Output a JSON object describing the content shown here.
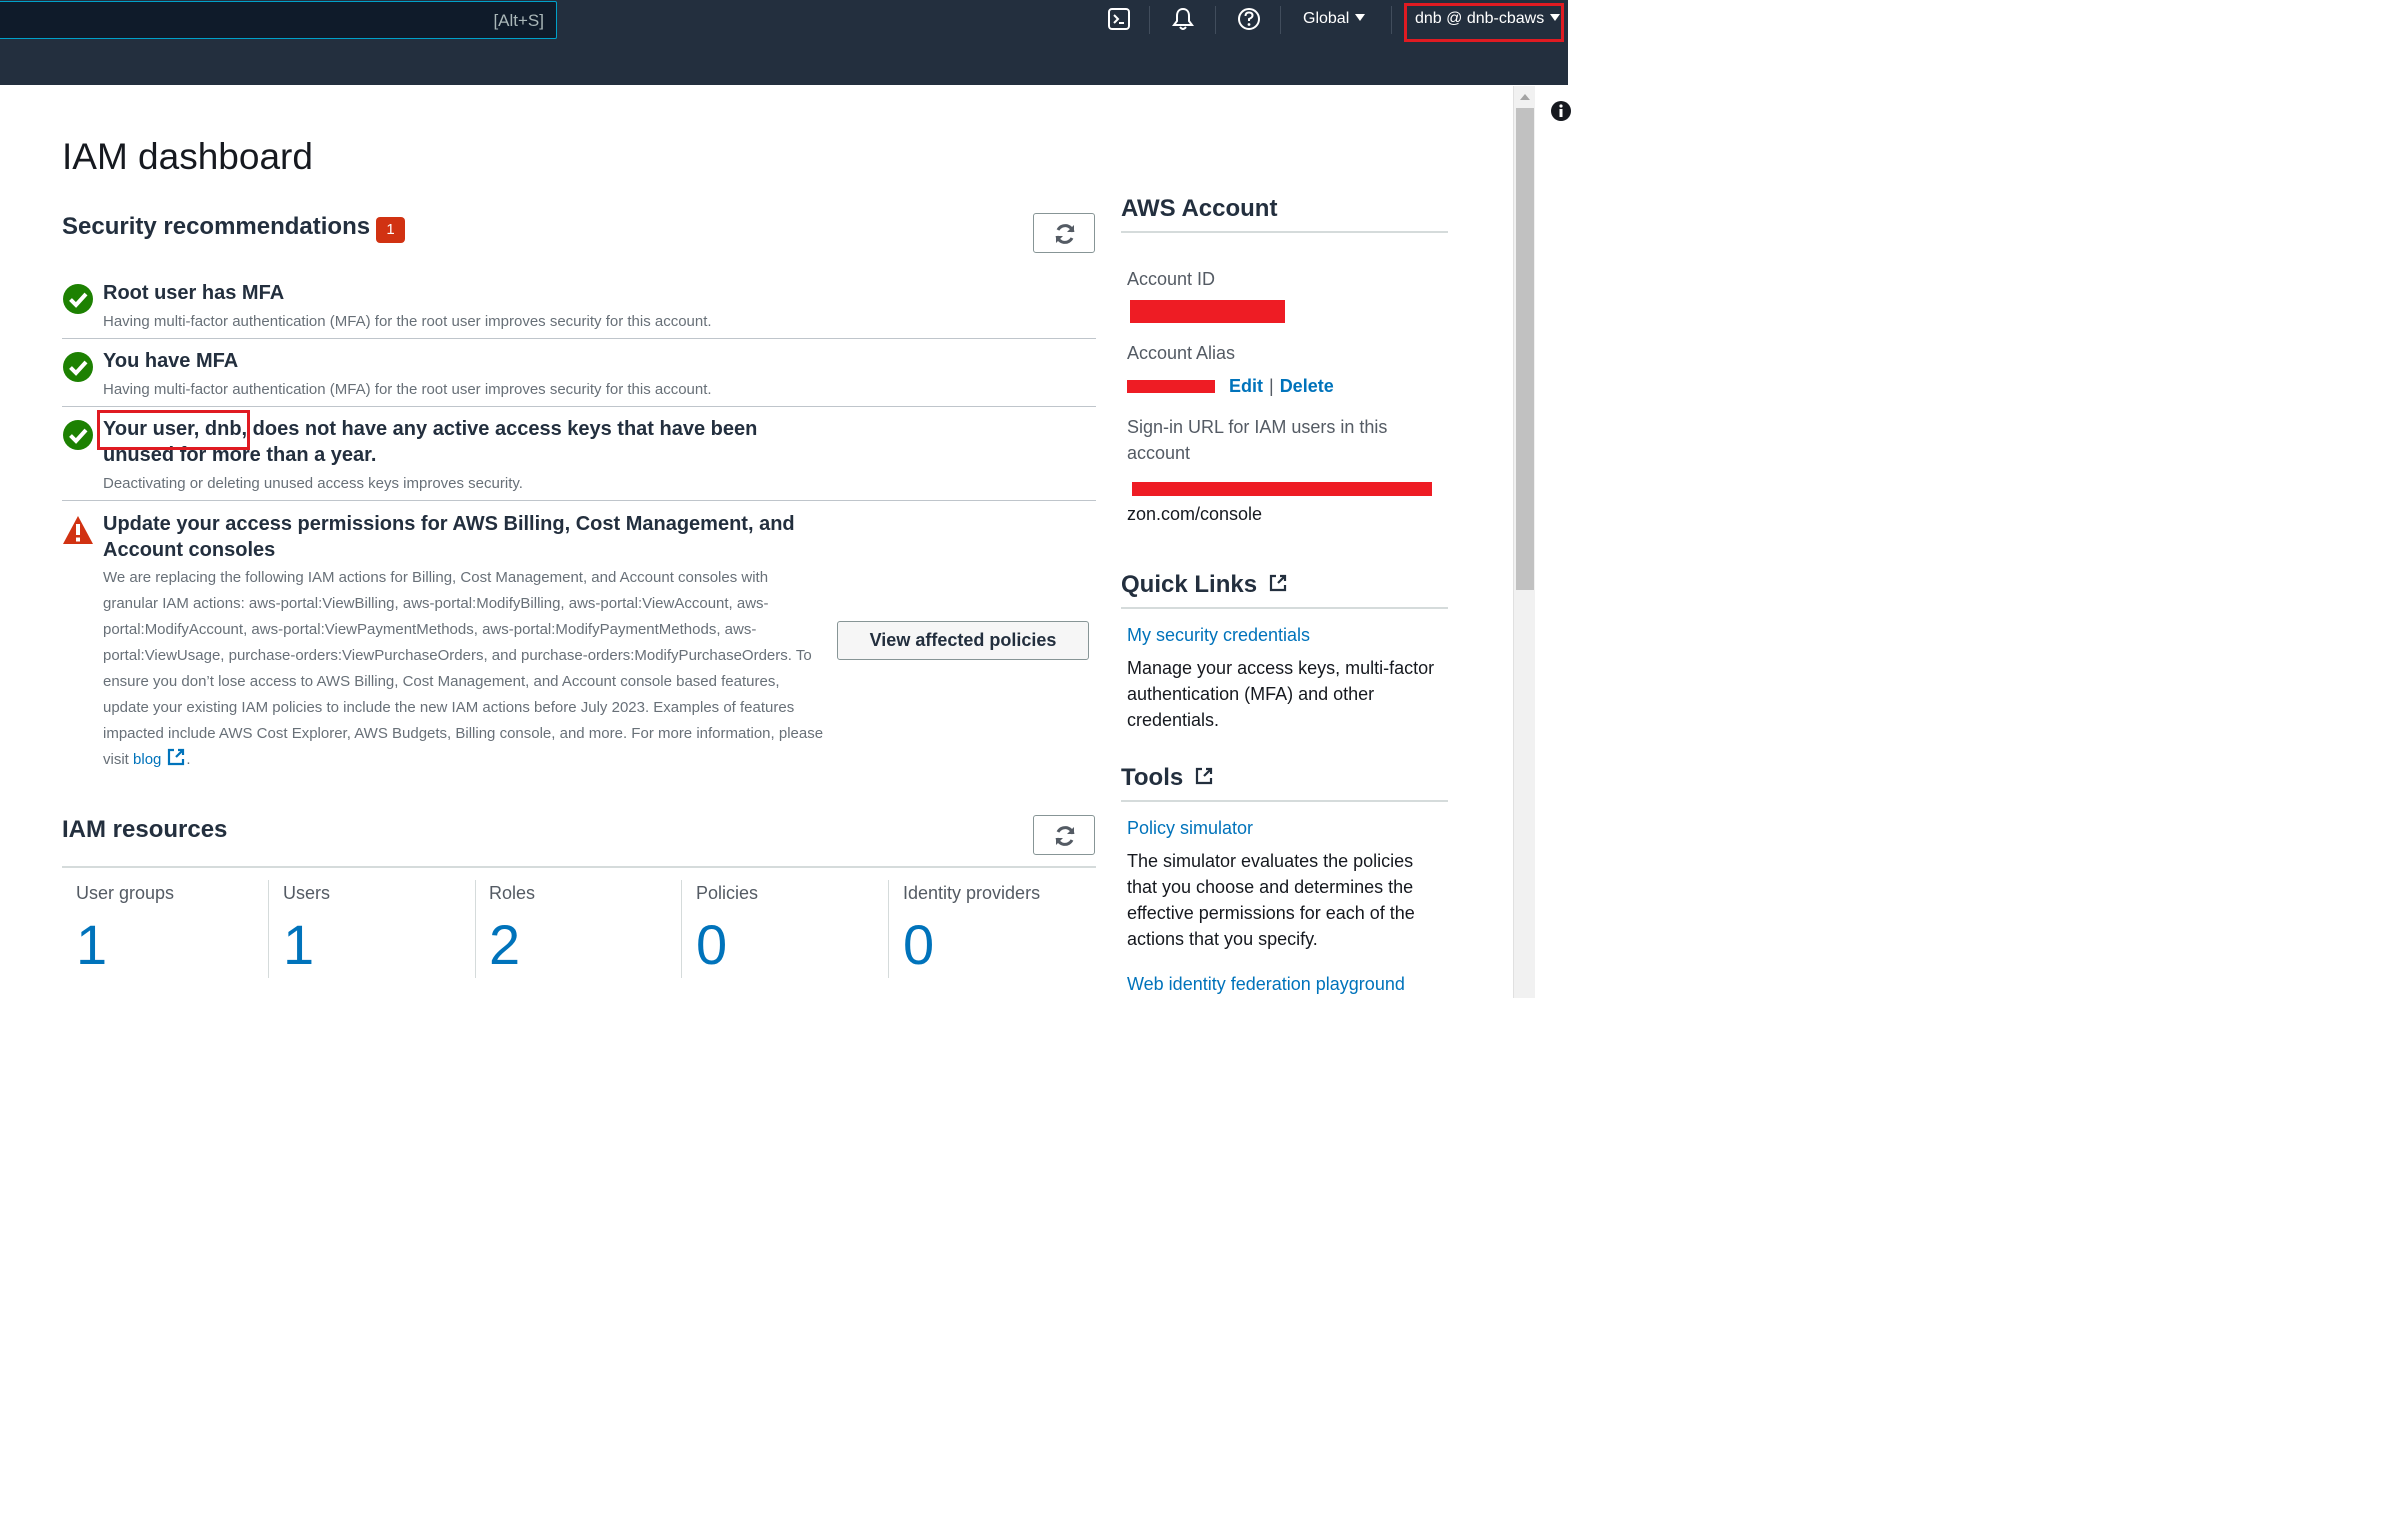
{
  "topnav": {
    "search_hint": "[Alt+S]",
    "region_label": "Global",
    "user_label": "dnb @ dnb-cbaws"
  },
  "page": {
    "title": "IAM dashboard"
  },
  "security": {
    "heading": "Security recommendations",
    "badge_count": "1",
    "items": [
      {
        "title": "Root user has MFA",
        "description": "Having multi-factor authentication (MFA) for the root user improves security for this account.",
        "status": "success"
      },
      {
        "title": "You have MFA",
        "description": "Having multi-factor authentication (MFA) for the root user improves security for this account.",
        "status": "success"
      },
      {
        "title": "Your user, dnb, does not have any active access keys that have been unused for more than a year.",
        "description": "Deactivating or deleting unused access keys improves security.",
        "status": "success"
      },
      {
        "title": "Update your access permissions for AWS Billing, Cost Management, and Account consoles",
        "description": "We are replacing the following IAM actions for Billing, Cost Management, and Account consoles with granular IAM actions: aws-portal:ViewBilling, aws-portal:ModifyBilling, aws-portal:ViewAccount, aws-portal:ModifyAccount, aws-portal:ViewPaymentMethods, aws-portal:ModifyPaymentMethods, aws-portal:ViewUsage, purchase-orders:ViewPurchaseOrders, and purchase-orders:ModifyPurchaseOrders. To ensure you don’t lose access to AWS Billing, Cost Management, and Account console based features, update your existing IAM policies to include the new IAM actions before July 2023. Examples of features impacted include AWS Cost Explorer, AWS Budgets, Billing console, and more. For more information, please visit",
        "link_text": "blog",
        "trailing": ".",
        "status": "warning",
        "button_label": "View affected policies"
      }
    ]
  },
  "resources": {
    "heading": "IAM resources",
    "items": [
      {
        "label": "User groups",
        "count": "1"
      },
      {
        "label": "Users",
        "count": "1"
      },
      {
        "label": "Roles",
        "count": "2"
      },
      {
        "label": "Policies",
        "count": "0"
      },
      {
        "label": "Identity providers",
        "count": "0"
      }
    ]
  },
  "account": {
    "heading": "AWS Account",
    "id_label": "Account ID",
    "alias_label": "Account Alias",
    "edit_label": "Edit",
    "delete_label": "Delete",
    "signin_label": "Sign-in URL for IAM users in this account",
    "signin_url_tail": "zon.com/console"
  },
  "quick_links": {
    "heading": "Quick Links",
    "link": "My security credentials",
    "description": "Manage your access keys, multi-factor authentication (MFA) and other credentials."
  },
  "tools": {
    "heading": "Tools",
    "link": "Policy simulator",
    "description": "The simulator evaluates the policies that you choose and determines the effective permissions for each of the actions that you specify.",
    "link2": "Web identity federation playground"
  },
  "colors": {
    "nav_bg": "#232f3e",
    "link": "#0073bb",
    "success": "#1d8102",
    "warning": "#d13212",
    "annotation": "#e01b22"
  }
}
